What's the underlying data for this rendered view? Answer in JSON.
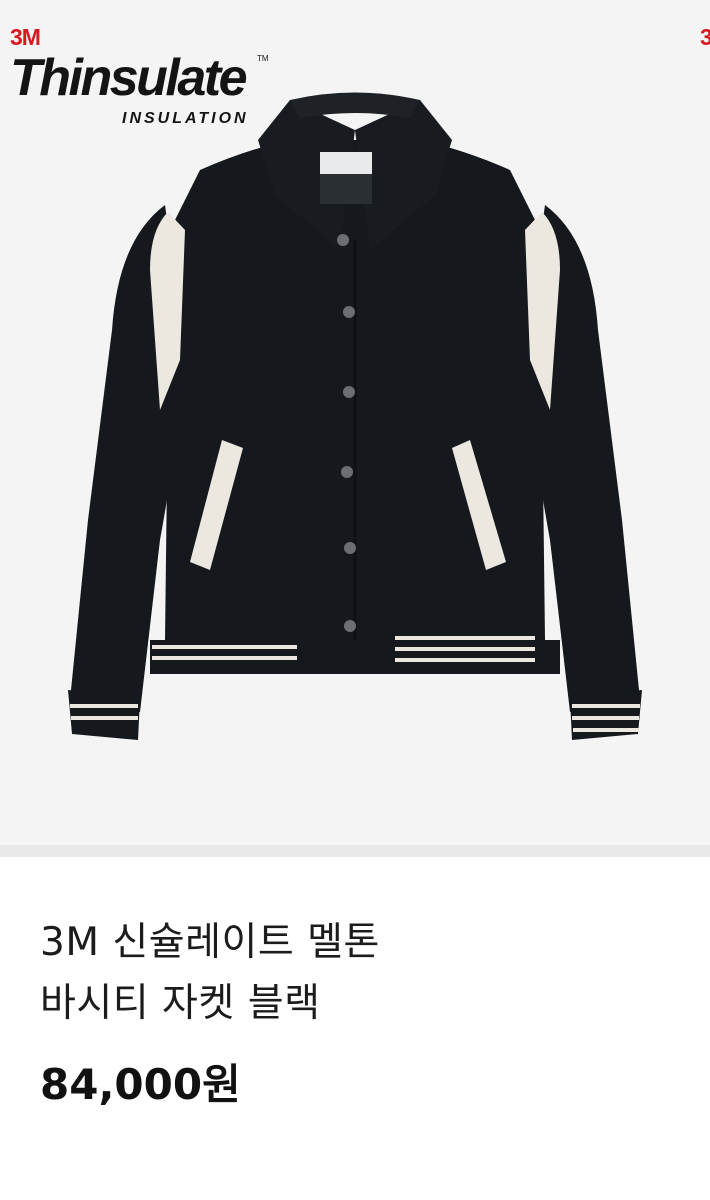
{
  "product_image": {
    "subject": "jacket-photo",
    "brand_logo": {
      "mark": "3M",
      "wordmark": "Thinsulate",
      "trademark": "TM",
      "tagline": "INSULATION"
    },
    "next_image_peek": "3"
  },
  "product": {
    "title_line1": "3M 신슐레이트 멜톤",
    "title_line2": "바시티 자켓 블랙",
    "price": "84,000원"
  },
  "colors": {
    "jacket_body": "#15191d",
    "sleeve_accent": "#ece8df",
    "logo_red": "#d71920",
    "background": "#f4f4f4"
  }
}
